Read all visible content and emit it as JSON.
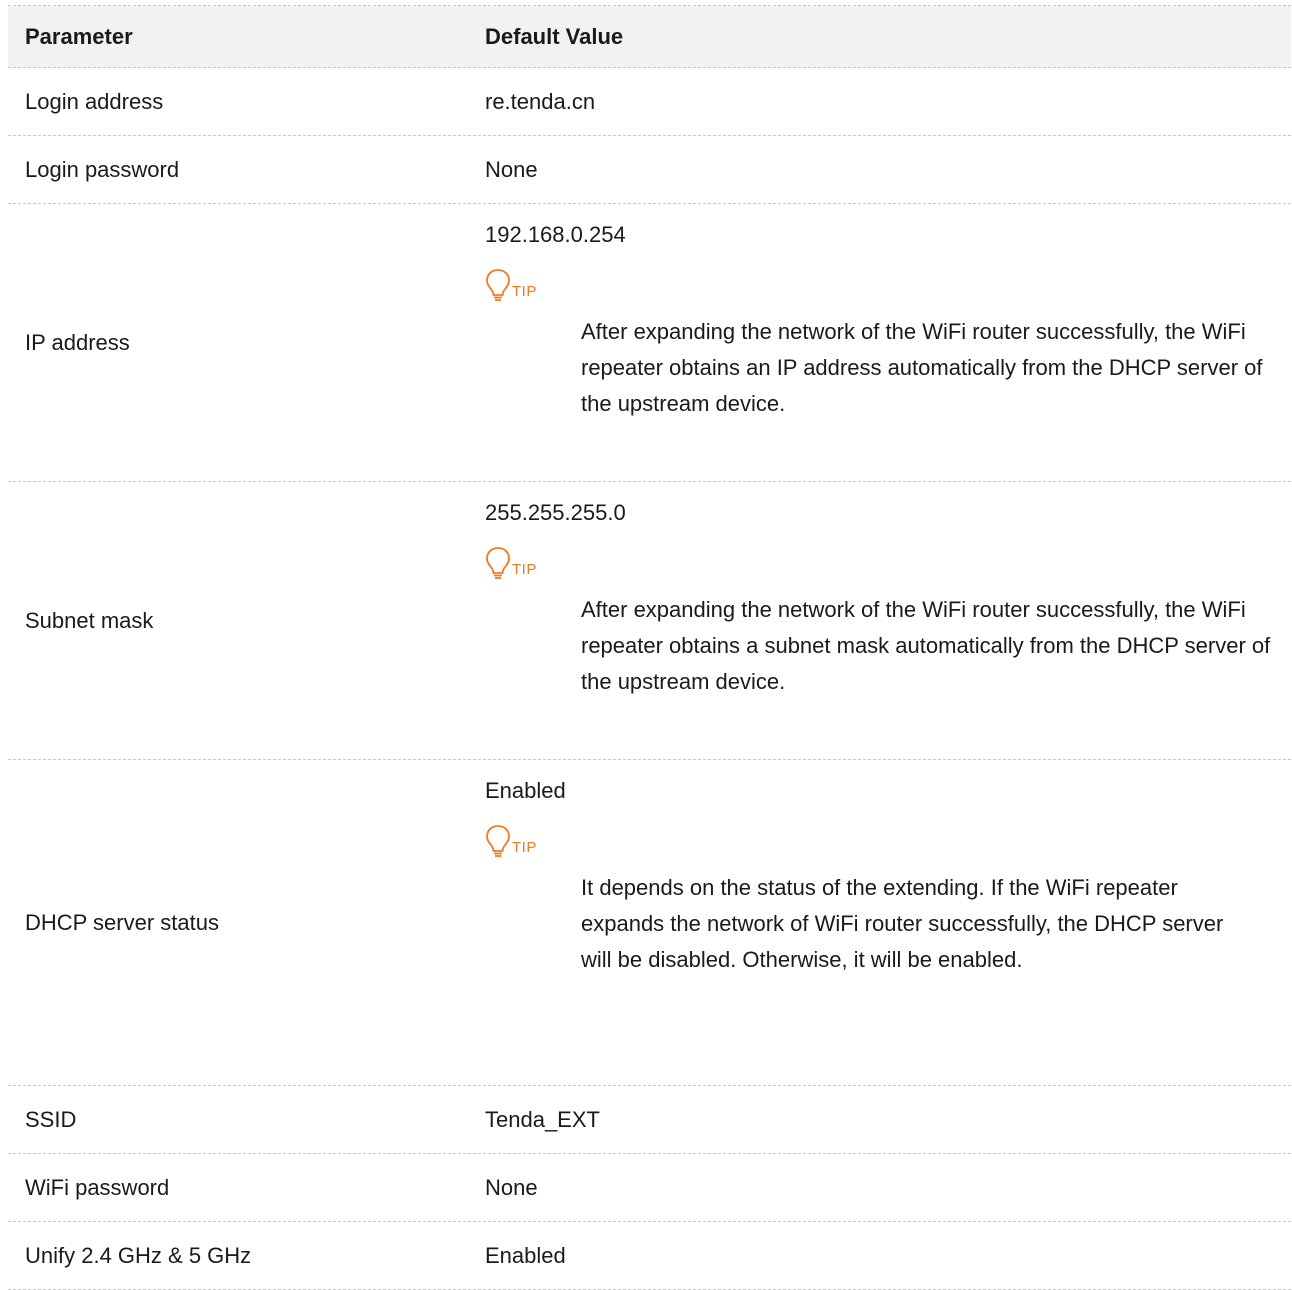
{
  "table": {
    "headers": {
      "parameter": "Parameter",
      "default_value": "Default Value"
    },
    "rows": [
      {
        "parameter": "Login address",
        "value": "re.tenda.cn"
      },
      {
        "parameter": "Login password",
        "value": "None"
      },
      {
        "parameter": "IP address",
        "value": "192.168.0.254",
        "tip_label": "TIP",
        "tip_text": "After expanding the network of the WiFi router successfully, the WiFi repeater obtains an IP address automatically from the DHCP server of the upstream device."
      },
      {
        "parameter": "Subnet mask",
        "value": "255.255.255.0",
        "tip_label": "TIP",
        "tip_text": "After expanding the network of the WiFi router successfully, the WiFi repeater obtains a subnet mask automatically from the DHCP server of the upstream device."
      },
      {
        "parameter": "DHCP server status",
        "value": "Enabled",
        "tip_label": "TIP",
        "tip_text": "It depends on the status of the extending. If the WiFi repeater expands the network of WiFi router successfully, the DHCP server will be disabled. Otherwise, it will be enabled."
      },
      {
        "parameter": "SSID",
        "value": "Tenda_EXT"
      },
      {
        "parameter": "WiFi password",
        "value": "None"
      },
      {
        "parameter": "Unify 2.4 GHz & 5 GHz",
        "value": "Enabled"
      }
    ]
  },
  "colors": {
    "tip_accent": "#f07a24",
    "header_bg": "#f2f2f2",
    "divider": "#c8c8c8"
  },
  "icons": {
    "tip": "lightbulb-icon"
  }
}
